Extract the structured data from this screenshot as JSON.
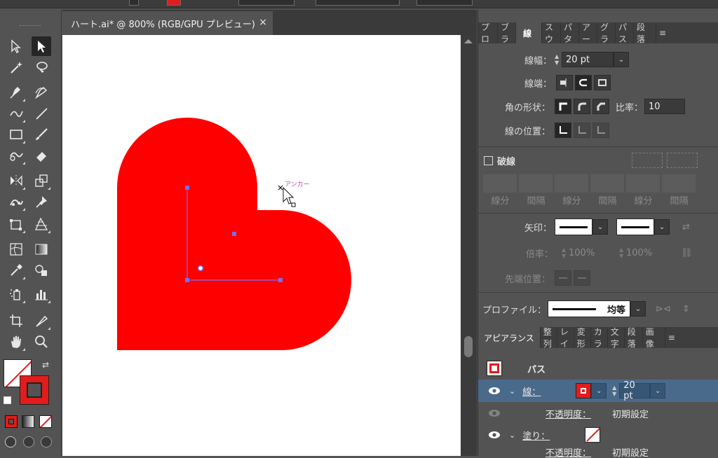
{
  "document_tab": {
    "title": "ハート.ai* @ 800% (RGB/GPU プレビュー)",
    "close": "×"
  },
  "canvas": {
    "anchor_hint": "アンカー",
    "zoom": "800%"
  },
  "colors": {
    "heart_fill": "#ff0000",
    "selection": "#7b6cf0",
    "ui_bg": "#535353",
    "panel_highlight": "#4a6a8c"
  },
  "stroke_panel": {
    "tabs": [
      "プロ",
      "ブラ",
      "線",
      "スウ",
      "パタ",
      "アー",
      "グラ",
      "パス",
      "段落"
    ],
    "active_tab": "線",
    "weight_label": "線幅：",
    "weight_value": "20 pt",
    "cap_label": "線端：",
    "corner_label": "角の形状：",
    "limit_label": "比率：",
    "limit_value": "10",
    "align_label": "線の位置：",
    "dashed_label": "破線",
    "dash_headers": [
      "線分",
      "間隔",
      "線分",
      "間隔",
      "線分",
      "間隔"
    ],
    "arrow_label": "矢印：",
    "scale_label": "倍率：",
    "scale_value_1": "100%",
    "scale_value_2": "100%",
    "tip_label": "先端位置：",
    "profile_label": "プロファイル：",
    "profile_value": "均等"
  },
  "appearance_panel": {
    "tabs": [
      "アピアランス",
      "整列",
      "レイ",
      "変形",
      "カラ",
      "文字",
      "段落",
      "画像"
    ],
    "active_tab": "アピアランス",
    "object_type": "パス",
    "stroke_label": "線：",
    "stroke_weight": "20 pt",
    "stroke_color": "#e21c1c",
    "opacity_label": "不透明度：",
    "opacity_value": "初期設定",
    "fill_label": "塗り：",
    "opacity_label_2": "不透明度：",
    "opacity_value_2": "初期設定"
  },
  "toolbar": {
    "tools": [
      "direct-selection",
      "selection",
      "magic-wand",
      "lasso",
      "pen",
      "curvature",
      "anchor-convert",
      "line",
      "rectangle",
      "paintbrush",
      "shaper",
      "eraser",
      "reflect",
      "scale",
      "puppet-warp",
      "pin",
      "free-transform",
      "perspective",
      "mesh",
      "gradient",
      "eyedropper",
      "blend",
      "symbol-sprayer",
      "column-graph",
      "artboard",
      "slice",
      "hand",
      "zoom"
    ],
    "active_tool": "selection"
  }
}
